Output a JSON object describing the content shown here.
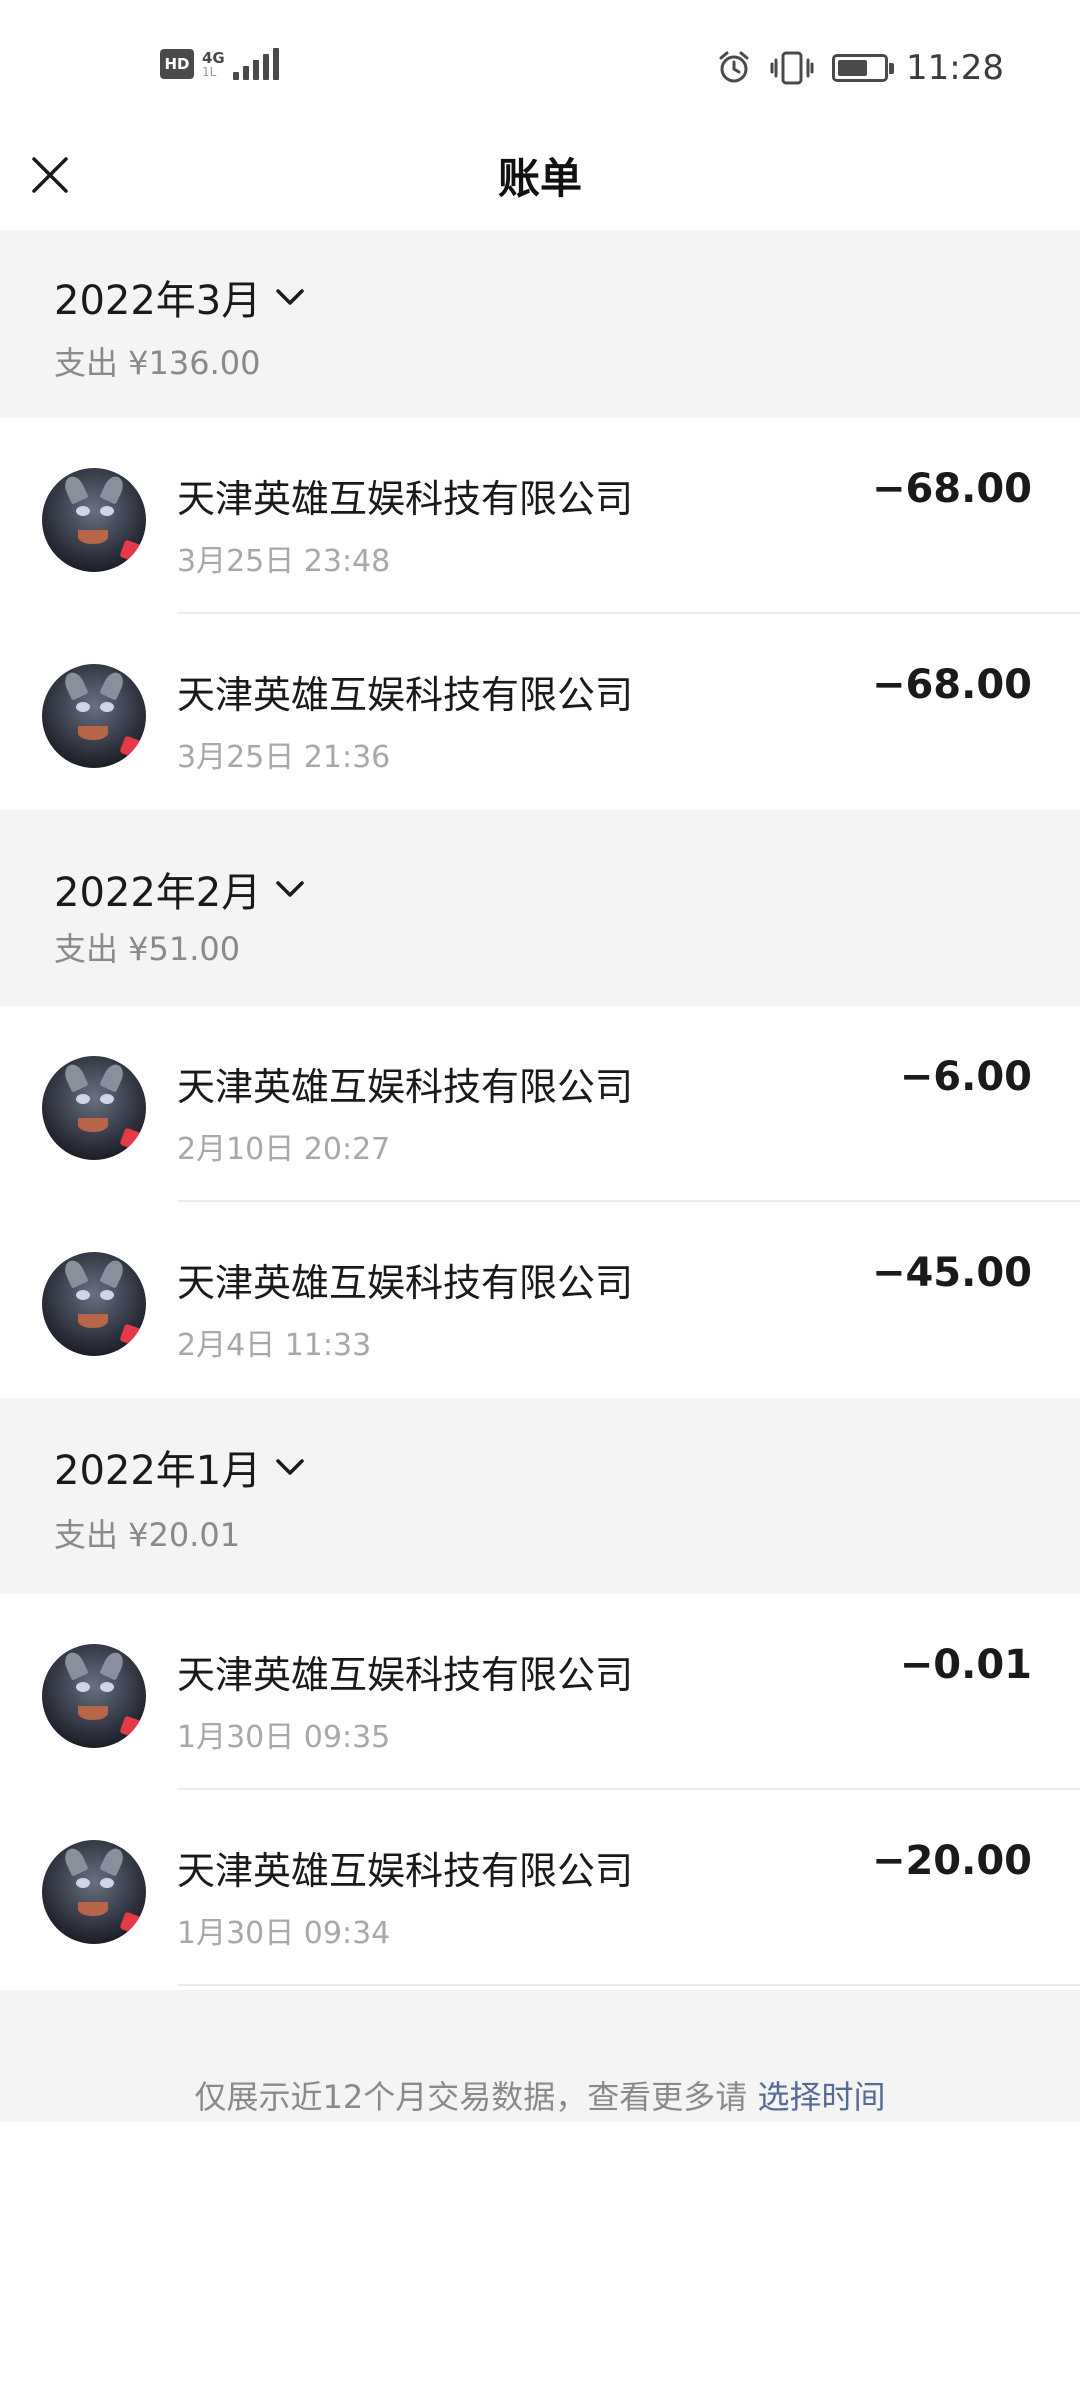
{
  "status_bar": {
    "hd": "HD",
    "network": "4G",
    "network_sub": "1L",
    "time": "11:28",
    "icons": [
      "alarm-icon",
      "vibrate-icon",
      "battery-icon"
    ],
    "battery_level": 0.65
  },
  "header": {
    "title": "账单",
    "close_icon": "close-icon"
  },
  "months": [
    {
      "title": "2022年3月",
      "total": "支出 ¥136.00",
      "transactions": [
        {
          "name": "天津英雄互娱科技有限公司",
          "time": "3月25日 23:48",
          "amount": "−68.00"
        },
        {
          "name": "天津英雄互娱科技有限公司",
          "time": "3月25日 21:36",
          "amount": "−68.00"
        }
      ]
    },
    {
      "title": "2022年2月",
      "total": "支出 ¥51.00",
      "transactions": [
        {
          "name": "天津英雄互娱科技有限公司",
          "time": "2月10日 20:27",
          "amount": "−6.00"
        },
        {
          "name": "天津英雄互娱科技有限公司",
          "time": "2月4日 11:33",
          "amount": "−45.00"
        }
      ]
    },
    {
      "title": "2022年1月",
      "total": "支出 ¥20.01",
      "transactions": [
        {
          "name": "天津英雄互娱科技有限公司",
          "time": "1月30日 09:35",
          "amount": "−0.01"
        },
        {
          "name": "天津英雄互娱科技有限公司",
          "time": "1月30日 09:34",
          "amount": "−20.00"
        }
      ]
    }
  ],
  "footer": {
    "text": "仅展示近12个月交易数据，查看更多请 ",
    "link": "选择时间"
  },
  "colors": {
    "background": "#ffffff",
    "section_bg": "#f4f4f4",
    "secondary_text": "#8a8a8a",
    "link": "#576b95",
    "avatar_tag": "#e53a45"
  }
}
